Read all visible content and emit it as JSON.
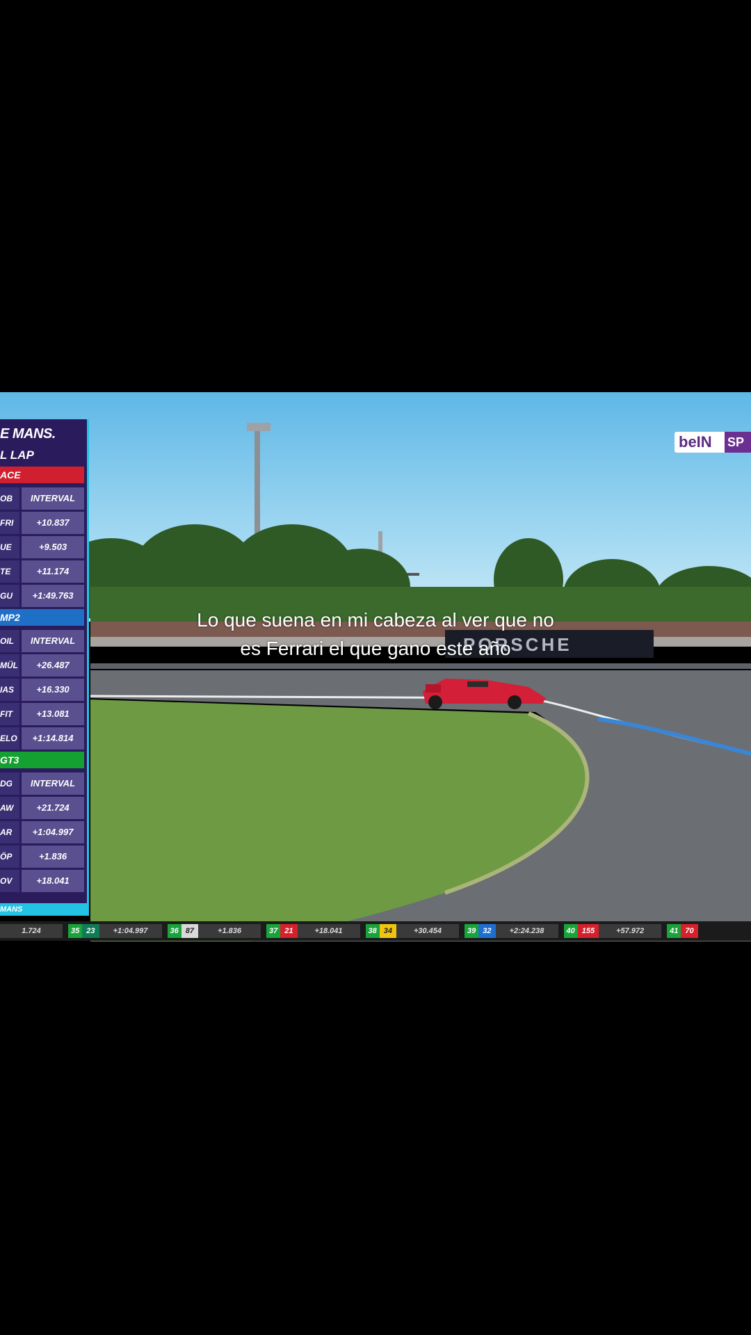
{
  "caption": {
    "line1": "Lo que suena en mi cabeza al ver que no",
    "line2": "es Ferrari el que gano este año"
  },
  "broadcaster_logo": {
    "text_left": "beIN",
    "text_right": "SP"
  },
  "trackside_banner": "PORSCHE",
  "timing_tower": {
    "brand": "E MANS.",
    "subtitle": "L LAP",
    "classes": [
      {
        "label": "ACE",
        "color": "#d0202f",
        "header": {
          "c1": "OB",
          "c2": "INTERVAL"
        },
        "rows": [
          {
            "c1": "FRI",
            "c2": "+10.837"
          },
          {
            "c1": "UE",
            "c2": "+9.503"
          },
          {
            "c1": "TE",
            "c2": "+11.174"
          },
          {
            "c1": "GU",
            "c2": "+1:49.763"
          }
        ]
      },
      {
        "label": "MP2",
        "color": "#1e6fc6",
        "header": {
          "c1": "OIL",
          "c2": "INTERVAL"
        },
        "rows": [
          {
            "c1": "MÜL",
            "c2": "+26.487"
          },
          {
            "c1": "IAS",
            "c2": "+16.330"
          },
          {
            "c1": "FIT",
            "c2": "+13.081"
          },
          {
            "c1": "ELO",
            "c2": "+1:14.814"
          }
        ]
      },
      {
        "label": "GT3",
        "color": "#15a032",
        "header": {
          "c1": "DG",
          "c2": "INTERVAL"
        },
        "rows": [
          {
            "c1": "AW",
            "c2": "+21.724"
          },
          {
            "c1": "AR",
            "c2": "+1:04.997"
          },
          {
            "c1": "ÖP",
            "c2": "+1.836"
          },
          {
            "c1": "OV",
            "c2": "+18.041"
          }
        ]
      }
    ],
    "footer": "MANS"
  },
  "ticker": [
    {
      "pos": "",
      "car": "",
      "gap": "1.724"
    },
    {
      "pos": "35",
      "car": "23",
      "gap": "+1:04.997"
    },
    {
      "pos": "36",
      "car": "87",
      "gap": "+1.836"
    },
    {
      "pos": "37",
      "car": "21",
      "gap": "+18.041"
    },
    {
      "pos": "38",
      "car": "34",
      "gap": "+30.454"
    },
    {
      "pos": "39",
      "car": "32",
      "gap": "+2:24.238"
    },
    {
      "pos": "40",
      "car": "155",
      "gap": "+57.972"
    },
    {
      "pos": "41",
      "car": "70",
      "gap": ""
    }
  ]
}
